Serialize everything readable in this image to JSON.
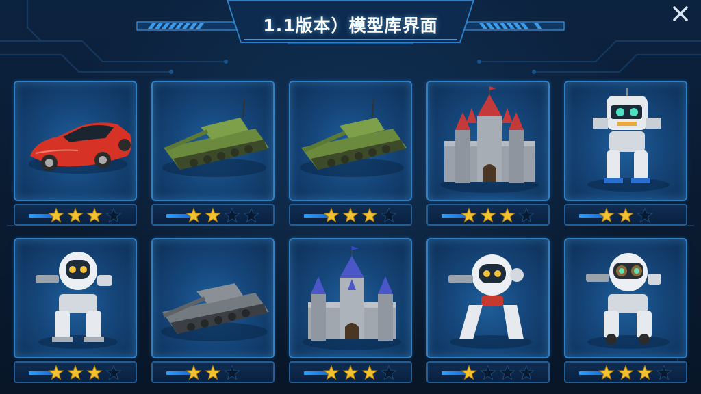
{
  "header": {
    "title": "1.1版本）模型库界面"
  },
  "close": {
    "icon": "close-icon"
  },
  "models": [
    {
      "subject": "red-sports-car",
      "rating": 3,
      "max_rating": 4
    },
    {
      "subject": "green-tank",
      "rating": 2,
      "max_rating": 4
    },
    {
      "subject": "green-tank",
      "rating": 3,
      "max_rating": 4
    },
    {
      "subject": "red-roof-castle",
      "rating": 3,
      "max_rating": 4
    },
    {
      "subject": "white-robot-mech",
      "rating": 2,
      "max_rating": 3
    },
    {
      "subject": "white-robot-mech",
      "rating": 3,
      "max_rating": 4
    },
    {
      "subject": "gray-tank",
      "rating": 2,
      "max_rating": 3
    },
    {
      "subject": "blue-roof-castle",
      "rating": 3,
      "max_rating": 4
    },
    {
      "subject": "round-robot",
      "rating": 1,
      "max_rating": 4
    },
    {
      "subject": "robot-with-goggles",
      "rating": 3,
      "max_rating": 4
    }
  ],
  "colors": {
    "accent": "#2f7fc4",
    "star_gold": "#f2c230",
    "star_blue": "#2aa0ff",
    "star_empty": "#071a30"
  }
}
